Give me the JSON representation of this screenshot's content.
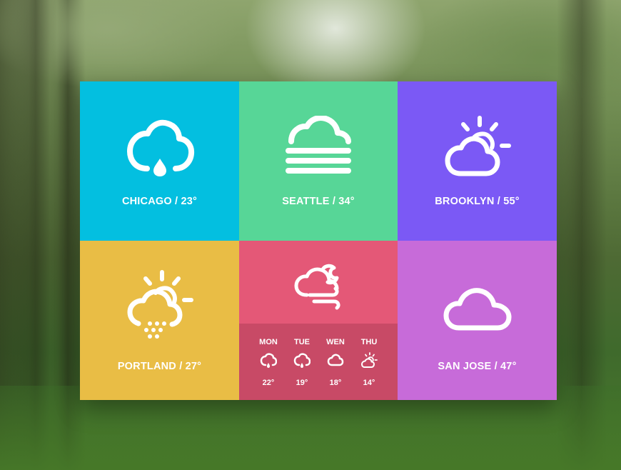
{
  "cities": [
    {
      "id": "chicago",
      "label": "CHICAGO / 23°",
      "icon": "cloud-rain-drop-icon",
      "color": "#03bfe0"
    },
    {
      "id": "seattle",
      "label": "SEATTLE / 34°",
      "icon": "fog-icon",
      "color": "#57d697"
    },
    {
      "id": "brooklyn",
      "label": "BROOKLYN / 55°",
      "icon": "partly-sunny-icon",
      "color": "#7b59f5"
    },
    {
      "id": "portland",
      "label": "PORTLAND / 27°",
      "icon": "sun-cloud-hail-icon",
      "color": "#e9bd45"
    },
    {
      "id": "sanjose",
      "label": "SAN JOSE / 47°",
      "icon": "cloud-icon",
      "color": "#c76bd9"
    }
  ],
  "forecast": {
    "icon": "night-cloud-wind-icon",
    "color": "#e45877",
    "days": [
      {
        "day": "MON",
        "temp": "22°",
        "icon": "cloud-rain-drop-icon"
      },
      {
        "day": "TUE",
        "temp": "19°",
        "icon": "cloud-rain-drop-icon"
      },
      {
        "day": "WEN",
        "temp": "18°",
        "icon": "cloud-icon"
      },
      {
        "day": "THU",
        "temp": "14°",
        "icon": "partly-sunny-icon"
      }
    ]
  }
}
